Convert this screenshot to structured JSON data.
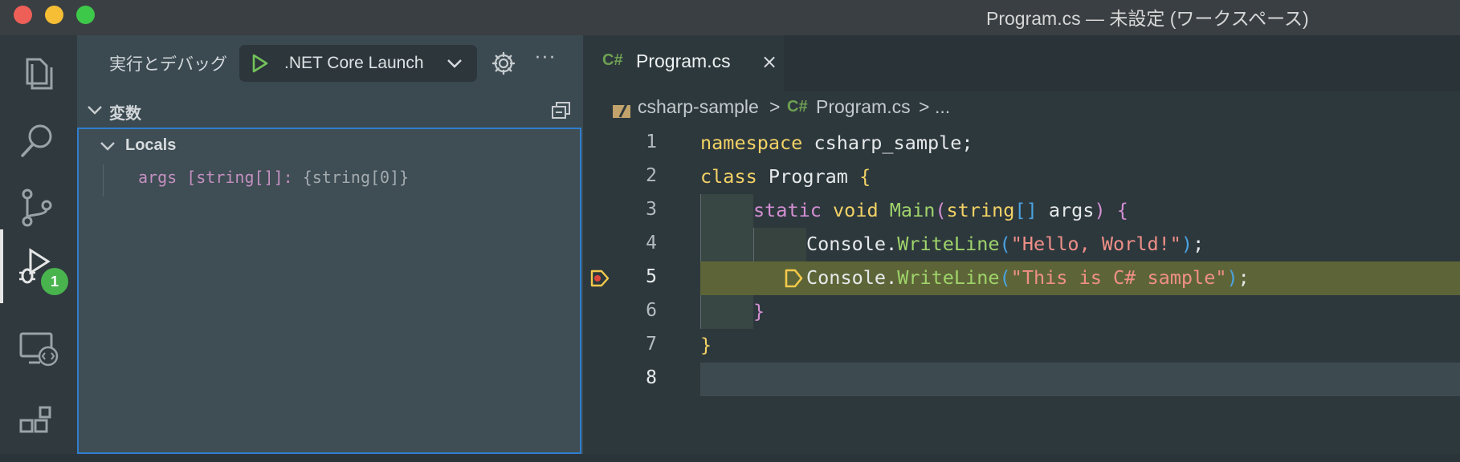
{
  "window": {
    "title": "Program.cs — 未設定 (ワークスペース)"
  },
  "activity_bar": {
    "items": [
      {
        "name": "explorer-icon"
      },
      {
        "name": "search-icon"
      },
      {
        "name": "source-control-icon"
      },
      {
        "name": "run-debug-icon",
        "active": true,
        "badge": "1"
      },
      {
        "name": "remote-explorer-icon"
      },
      {
        "name": "extensions-icon"
      }
    ]
  },
  "sidebar": {
    "title": "実行とデバッグ",
    "launch_config": ".NET Core Launch",
    "more": "···",
    "variables": {
      "title": "変数",
      "scopes": [
        {
          "label": "Locals",
          "vars": [
            {
              "name": "args",
              "type": "[string[]]:",
              "value": "{string[0]}"
            }
          ]
        }
      ]
    }
  },
  "editor": {
    "tab": {
      "lang": "C#",
      "file": "Program.cs",
      "close": "×"
    },
    "breadcrumb": {
      "folder": "csharp-sample",
      "sep1": ">",
      "lang": "C#",
      "file": "Program.cs",
      "sep2": ">",
      "tail": "..."
    },
    "current_line": 5,
    "lines": [
      {
        "n": "1"
      },
      {
        "n": "2"
      },
      {
        "n": "3"
      },
      {
        "n": "4"
      },
      {
        "n": "5"
      },
      {
        "n": "6"
      },
      {
        "n": "7"
      },
      {
        "n": "8"
      }
    ],
    "code": {
      "l1_kw": "namespace",
      "l1_rest": " csharp_sample;",
      "l2_kw": "class",
      "l2_rest": " Program ",
      "l2_br": "{",
      "l3_kw1": "static",
      "l3_kw2": " void ",
      "l3_fn": "Main",
      "l3_p1": "(",
      "l3_kw3": "string",
      "l3_arr": "[]",
      "l3_rest": " args",
      "l3_p2": ")",
      "l3_br": " {",
      "l4_obj": "Console.",
      "l4_fn": "WriteLine",
      "l4_p1": "(",
      "l4_str": "\"Hello, World!\"",
      "l4_p2": ")",
      "l4_end": ";",
      "l5_obj": "Console.",
      "l5_fn": "WriteLine",
      "l5_p1": "(",
      "l5_str": "\"This is C# sample\"",
      "l5_p2": ")",
      "l5_end": ";",
      "l6_br": "}",
      "l7_br": "}"
    }
  },
  "colors": {
    "accent": "#2f7fd0",
    "badge": "#49b44e",
    "debug_line": "#5d6538",
    "breakpoint": "#e0463a",
    "debug_arrow": "#f3c94a"
  }
}
